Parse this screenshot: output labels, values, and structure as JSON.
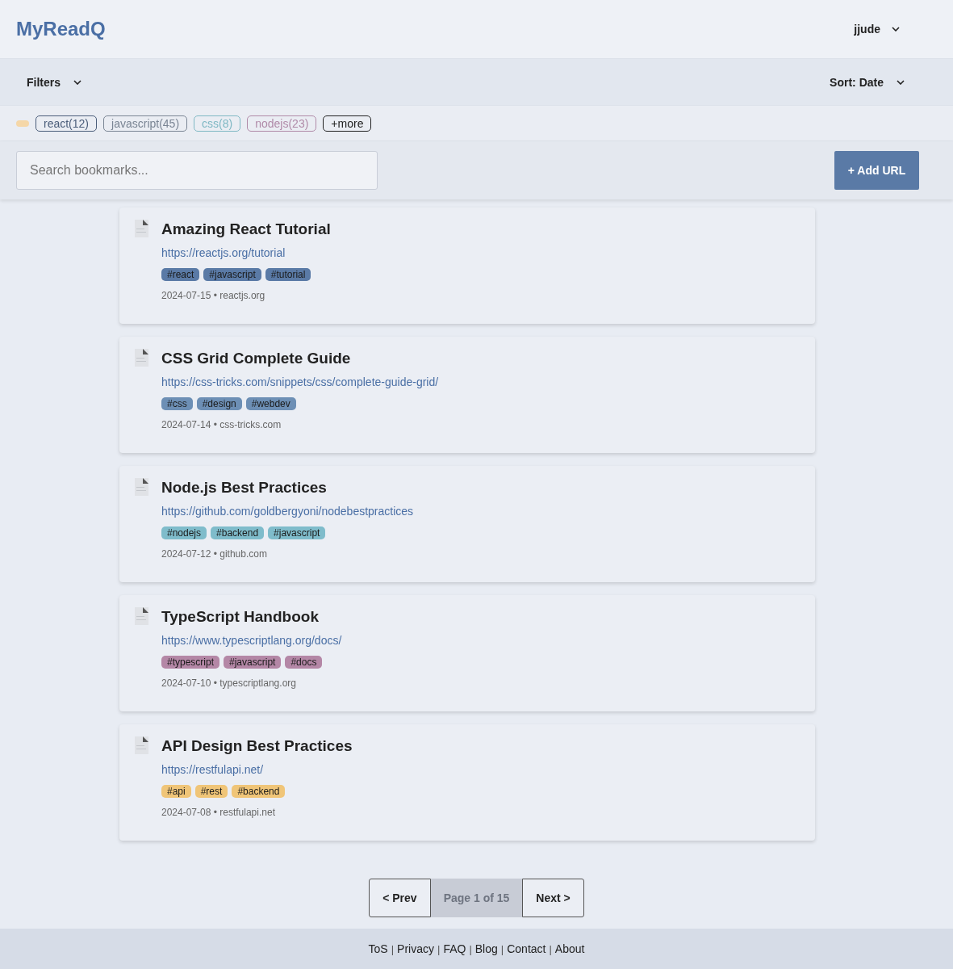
{
  "header": {
    "logo": "MyReadQ",
    "user": "jjude"
  },
  "toolbar": {
    "filters": "Filters",
    "sort": "Sort: Date"
  },
  "tag_filters": [
    {
      "label": "react(12)",
      "color": "#4a5d7a"
    },
    {
      "label": "javascript(45)",
      "color": "#7a8594"
    },
    {
      "label": "css(8)",
      "color": "#7fb8c4"
    },
    {
      "label": "nodejs(23)",
      "color": "#b08aa8"
    },
    {
      "label": "+more",
      "color": "#222222"
    }
  ],
  "search": {
    "placeholder": "Search bookmarks...",
    "button": "+ Add URL"
  },
  "bookmarks": [
    {
      "title": "Amazing React Tutorial",
      "url": "https://reactjs.org/tutorial",
      "tags": [
        "#react",
        "#javascript",
        "#tutorial"
      ],
      "color": "#5a7aa6",
      "meta": "2024-07-15 • reactjs.org"
    },
    {
      "title": "CSS Grid Complete Guide",
      "url": "https://css-tricks.com/snippets/css/complete-guide-grid/",
      "tags": [
        "#css",
        "#design",
        "#webdev"
      ],
      "color": "#6d8fb5",
      "meta": "2024-07-14 • css-tricks.com"
    },
    {
      "title": "Node.js Best Practices",
      "url": "https://github.com/goldbergyoni/nodebestpractices",
      "tags": [
        "#nodejs",
        "#backend",
        "#javascript"
      ],
      "color": "#7fbccb",
      "meta": "2024-07-12 • github.com"
    },
    {
      "title": "TypeScript Handbook",
      "url": "https://www.typescriptlang.org/docs/",
      "tags": [
        "#typescript",
        "#javascript",
        "#docs"
      ],
      "color": "#b487a6",
      "meta": "2024-07-10 • typescriptlang.org"
    },
    {
      "title": "API Design Best Practices",
      "url": "https://restfulapi.net/",
      "tags": [
        "#api",
        "#rest",
        "#backend"
      ],
      "color": "#f0c578",
      "meta": "2024-07-08 • restfulapi.net"
    }
  ],
  "pagination": {
    "prev": "< Prev",
    "page": "Page 1 of 15",
    "next": "Next >"
  },
  "footer": [
    {
      "kind": "link",
      "text": "ToS"
    },
    {
      "kind": "separator",
      "text": "|"
    },
    {
      "kind": "link",
      "text": "Privacy"
    },
    {
      "kind": "separator",
      "text": "|"
    },
    {
      "kind": "link",
      "text": "FAQ"
    },
    {
      "kind": "separator",
      "text": "|"
    },
    {
      "kind": "link",
      "text": "Blog"
    },
    {
      "kind": "separator",
      "text": "|"
    },
    {
      "kind": "link",
      "text": "Contact"
    },
    {
      "kind": "separator",
      "text": "|"
    },
    {
      "kind": "link",
      "text": "About"
    }
  ]
}
